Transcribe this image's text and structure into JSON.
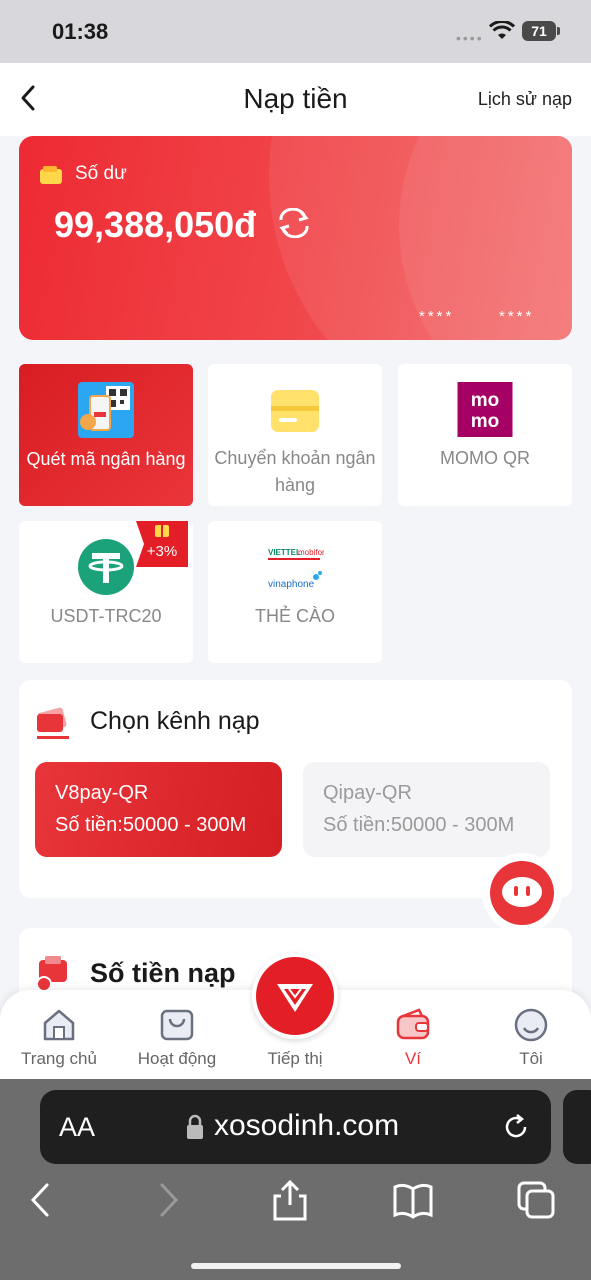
{
  "status_bar": {
    "time": "01:38",
    "battery": "71"
  },
  "header": {
    "title": "Nạp tiền",
    "history_link": "Lịch sử nạp"
  },
  "balance": {
    "label": "Số dư",
    "amount": "99,388,050đ",
    "mask1": "****",
    "mask2": "****"
  },
  "methods": [
    {
      "label": "Quét mã ngân hàng",
      "icon": "qr-scan-icon",
      "active": true
    },
    {
      "label": "Chuyển khoản ngân hàng",
      "icon": "bank-card-icon",
      "active": false
    },
    {
      "label": "MOMO QR",
      "icon": "momo-logo-icon",
      "active": false
    },
    {
      "label": "USDT-TRC20",
      "icon": "tether-icon",
      "active": false,
      "badge": "+3%"
    },
    {
      "label": "THẺ CÀO",
      "icon": "telecom-logos-icon",
      "active": false
    }
  ],
  "channel": {
    "title": "Chọn kênh nạp",
    "options": [
      {
        "name": "V8pay-QR",
        "range": "Số tiền:50000 - 300M",
        "active": true
      },
      {
        "name": "Qipay-QR",
        "range": "Số tiền:50000 - 300M",
        "active": false
      }
    ]
  },
  "amount_section": {
    "title": "Số tiền nạp"
  },
  "tabbar": [
    {
      "label": "Trang chủ",
      "icon": "home-icon",
      "active": false
    },
    {
      "label": "Hoạt động",
      "icon": "bag-icon",
      "active": false
    },
    {
      "label": "Tiếp thị",
      "icon": "diamond-logo-icon",
      "active": false
    },
    {
      "label": "Ví",
      "icon": "wallet-icon",
      "active": true
    },
    {
      "label": "Tôi",
      "icon": "profile-icon",
      "active": false
    }
  ],
  "browser": {
    "aa": "AA",
    "url": "xosodinh.com"
  },
  "colors": {
    "primary": "#e8353a",
    "background": "#f4f5f9"
  }
}
